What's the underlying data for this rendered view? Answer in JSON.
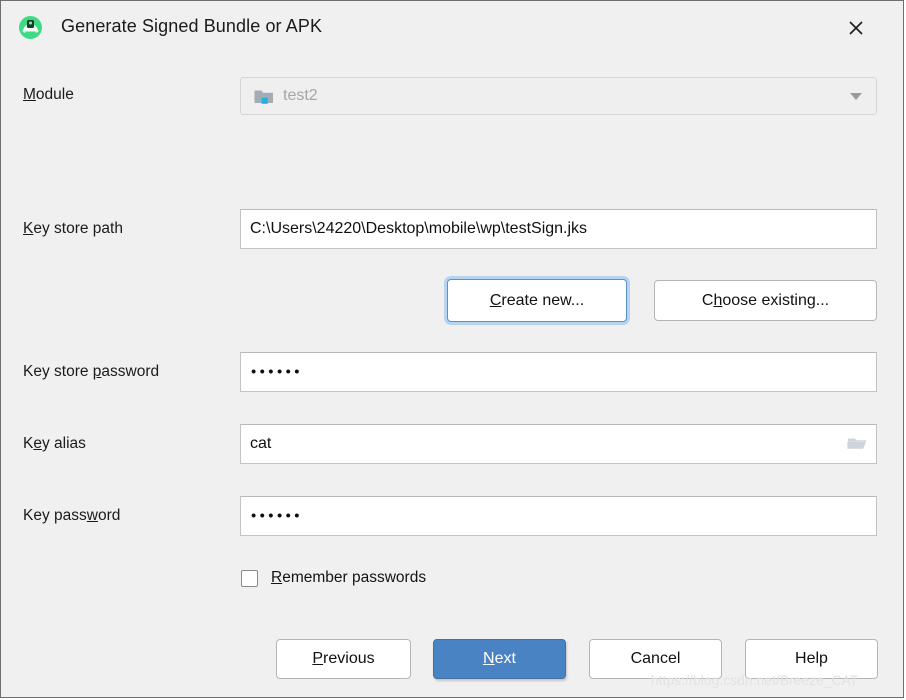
{
  "window": {
    "title": "Generate Signed Bundle or APK",
    "app_icon": "android-studio-icon",
    "close_icon": "close-icon",
    "background_color": "#f0f0f0",
    "border_color": "#6e6e6e"
  },
  "fields": {
    "module": {
      "label": "Module",
      "label_mnemonic": "M",
      "value": "test2",
      "icon": "android-module-folder-icon",
      "disabled": true,
      "dropdown_icon": "chevron-down-icon"
    },
    "key_store_path": {
      "label": "Key store path",
      "label_mnemonic": "K",
      "value": "C:\\Users\\24220\\Desktop\\mobile\\wp\\testSign.jks",
      "placeholder": ""
    },
    "key_store_password": {
      "label": "Key store password",
      "label_mnemonic": "p",
      "value": "••••••",
      "masked_char_count": 6
    },
    "key_alias": {
      "label": "Key alias",
      "label_mnemonic": "e",
      "value": "cat",
      "browse_icon": "folder-open-icon"
    },
    "key_password": {
      "label": "Key password",
      "label_mnemonic": "w",
      "value": "••••••",
      "masked_char_count": 6
    }
  },
  "keystore_actions": {
    "create_new": {
      "label": "Create new...",
      "mnemonic": "C",
      "focused": true
    },
    "choose_existing": {
      "label": "Choose existing...",
      "mnemonic": "h",
      "focused": false
    }
  },
  "remember_passwords": {
    "label": "Remember passwords",
    "mnemonic": "R",
    "checked": false
  },
  "footer": {
    "previous": {
      "label": "Previous",
      "mnemonic": "P"
    },
    "next": {
      "label": "Next",
      "mnemonic": "N",
      "is_default": true
    },
    "cancel": {
      "label": "Cancel"
    },
    "help": {
      "label": "Help"
    }
  },
  "colors": {
    "default_button_blue": "#4a83c4",
    "focus_ring_blue": "#b6d3ef",
    "module_badge_blue": "#29b0e2",
    "android_green": "#3ddc84"
  },
  "watermark": "https://blog.csdn.net/Breeze_CAT"
}
